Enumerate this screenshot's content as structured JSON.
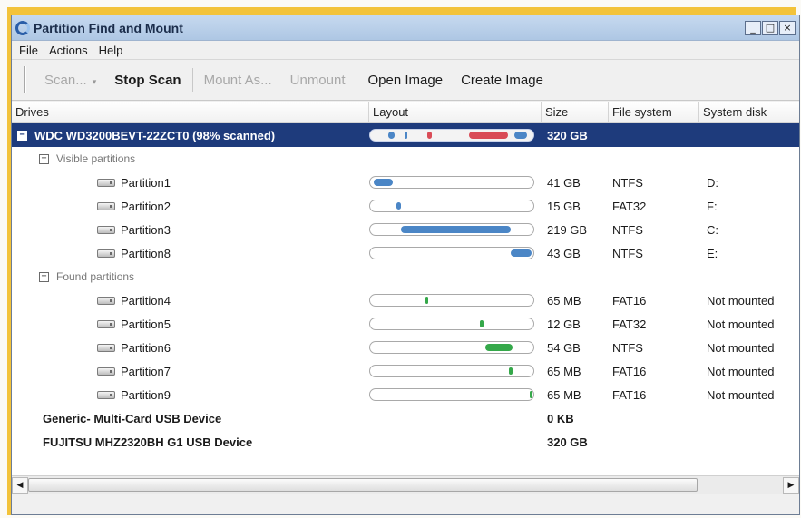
{
  "window": {
    "title": "Partition Find and Mount",
    "controls": [
      "_",
      "□",
      "×"
    ]
  },
  "menu": [
    "File",
    "Actions",
    "Help"
  ],
  "toolbar": {
    "scan": "Scan...",
    "stop_scan": "Stop Scan",
    "mount_as": "Mount As...",
    "unmount": "Unmount",
    "open_image": "Open Image",
    "create_image": "Create Image"
  },
  "columns": {
    "drives": "Drives",
    "layout": "Layout",
    "size": "Size",
    "file_system": "File system",
    "system_disk": "System disk"
  },
  "rows": [
    {
      "kind": "drive",
      "selected": true,
      "expander": "−",
      "name": "WDC WD3200BEVT-22ZCT0  (98% scanned)",
      "size": "320 GB",
      "fs": "",
      "sys": "",
      "segments": [
        {
          "start": 0.1,
          "end": 0.14,
          "color": "#4b86c6"
        },
        {
          "start": 0.2,
          "end": 0.22,
          "color": "#4b86c6"
        },
        {
          "start": 0.34,
          "end": 0.37,
          "color": "#d94b56"
        },
        {
          "start": 0.6,
          "end": 0.84,
          "color": "#d94b56"
        },
        {
          "start": 0.88,
          "end": 0.96,
          "color": "#4b86c6"
        }
      ]
    },
    {
      "kind": "group",
      "expander": "−",
      "name": "Visible partitions"
    },
    {
      "kind": "partition",
      "name": "Partition1",
      "size": "41 GB",
      "fs": "NTFS",
      "sys": "D:",
      "segments": [
        {
          "start": 0.01,
          "end": 0.13,
          "color": "#4b86c6"
        }
      ]
    },
    {
      "kind": "partition",
      "name": "Partition2",
      "size": "15 GB",
      "fs": "FAT32",
      "sys": "F:",
      "segments": [
        {
          "start": 0.15,
          "end": 0.18,
          "color": "#4b86c6"
        }
      ]
    },
    {
      "kind": "partition",
      "name": "Partition3",
      "size": "219 GB",
      "fs": "NTFS",
      "sys": "C:",
      "segments": [
        {
          "start": 0.18,
          "end": 0.86,
          "color": "#4b86c6"
        }
      ]
    },
    {
      "kind": "partition",
      "name": "Partition8",
      "size": "43 GB",
      "fs": "NTFS",
      "sys": "E:",
      "segments": [
        {
          "start": 0.86,
          "end": 0.99,
          "color": "#4b86c6"
        }
      ]
    },
    {
      "kind": "group",
      "expander": "−",
      "name": "Found partitions"
    },
    {
      "kind": "partition",
      "name": "Partition4",
      "size": "65 MB",
      "fs": "FAT16",
      "sys": "Not mounted",
      "segments": [
        {
          "start": 0.33,
          "end": 0.35,
          "color": "#35a84a"
        }
      ]
    },
    {
      "kind": "partition",
      "name": "Partition5",
      "size": "12 GB",
      "fs": "FAT32",
      "sys": "Not mounted",
      "segments": [
        {
          "start": 0.67,
          "end": 0.69,
          "color": "#35a84a"
        }
      ]
    },
    {
      "kind": "partition",
      "name": "Partition6",
      "size": "54 GB",
      "fs": "NTFS",
      "sys": "Not mounted",
      "segments": [
        {
          "start": 0.7,
          "end": 0.87,
          "color": "#35a84a"
        }
      ]
    },
    {
      "kind": "partition",
      "name": "Partition7",
      "size": "65 MB",
      "fs": "FAT16",
      "sys": "Not mounted",
      "segments": [
        {
          "start": 0.85,
          "end": 0.87,
          "color": "#35a84a"
        }
      ]
    },
    {
      "kind": "partition",
      "name": "Partition9",
      "size": "65 MB",
      "fs": "FAT16",
      "sys": "Not mounted",
      "segments": [
        {
          "start": 0.975,
          "end": 0.995,
          "color": "#35a84a"
        }
      ]
    },
    {
      "kind": "drive",
      "selected": false,
      "name": "Generic- Multi-Card USB Device",
      "size": "0 KB",
      "fs": "",
      "sys": ""
    },
    {
      "kind": "drive",
      "selected": false,
      "name": "FUJITSU MHZ2320BH G1 USB Device",
      "size": "320 GB",
      "fs": "",
      "sys": ""
    }
  ],
  "icons": {
    "app": "partition-app-icon",
    "disk": "hard-disk-icon",
    "scroll_left": "◀",
    "scroll_right": "▶",
    "dropdown": "▾"
  },
  "colors": {
    "title_bar": "#aec7e4",
    "selection": "#1e3b7c",
    "visible_partition": "#4b86c6",
    "found_partition": "#35a84a",
    "bad_area": "#d94b56",
    "frame": "#f3c33a"
  }
}
